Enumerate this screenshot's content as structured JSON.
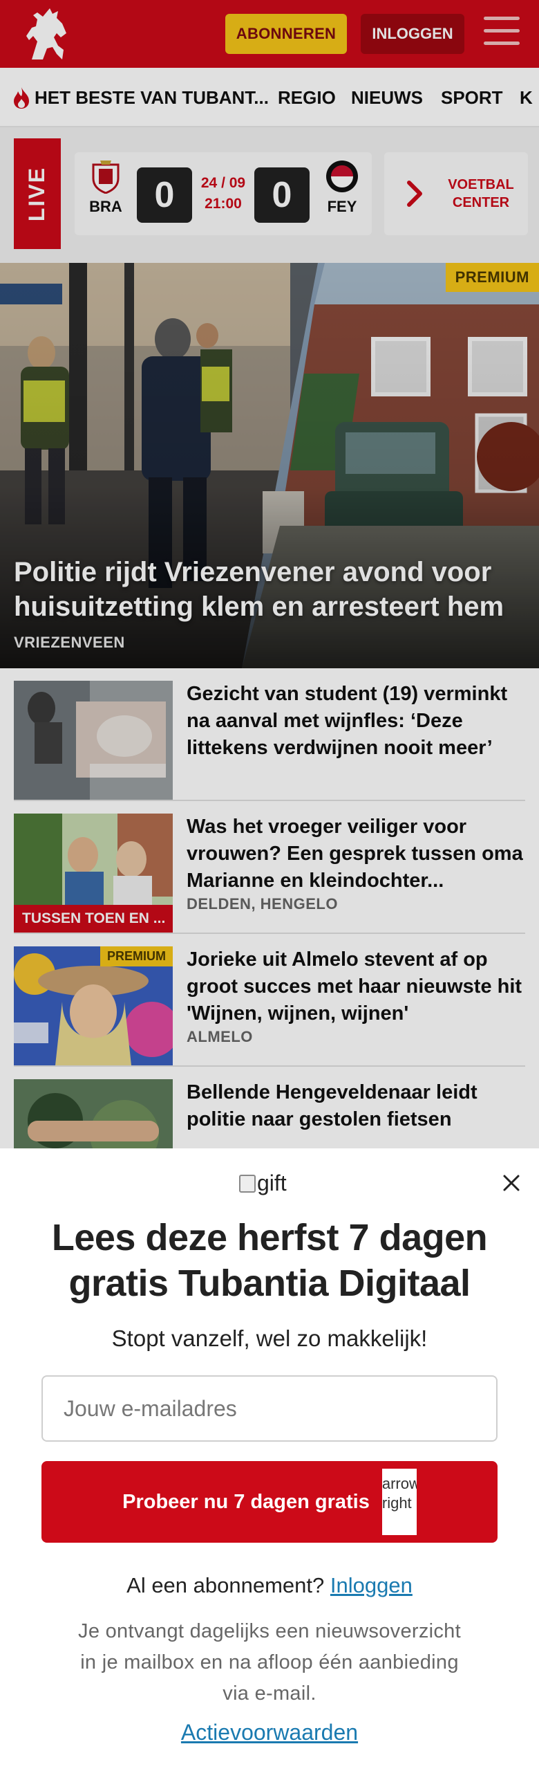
{
  "header": {
    "subscribe_label": "ABONNEREN",
    "login_label": "INLOGGEN",
    "brand_color": "#cc0a18"
  },
  "nav": {
    "items": [
      {
        "label": "HET BESTE VAN TUBANT..."
      },
      {
        "label": "REGIO"
      },
      {
        "label": "NIEUWS"
      },
      {
        "label": "SPORT"
      },
      {
        "label": "K"
      }
    ]
  },
  "live": {
    "tag": "LIVE",
    "home_team": "BRA",
    "away_team": "FEY",
    "home_score": "0",
    "away_score": "0",
    "date": "24 / 09",
    "time": "21:00",
    "voetbal_line1": "VOETBAL",
    "voetbal_line2": "CENTER"
  },
  "hero": {
    "badge": "PREMIUM",
    "title": "Politie rijdt Vriezenvener avond voor huisuitzetting klem en arresteert hem",
    "tag": "VRIEZENVEEN"
  },
  "articles": [
    {
      "title": "Gezicht van student (19) verminkt na aanval met wijnfles: ‘Deze littekens verdwijnen nooit meer’",
      "tag": "",
      "thumb_label": "",
      "premium": ""
    },
    {
      "title": "Was het vroeger veiliger voor vrouwen? Een gesprek tussen oma Marianne en kleindochter...",
      "tag": "DELDEN, HENGELO",
      "thumb_label": "TUSSEN TOEN EN ...",
      "premium": ""
    },
    {
      "title": "Jorieke uit Almelo stevent af op groot succes met haar nieuwste hit 'Wijnen, wijnen, wijnen'",
      "tag": "ALMELO",
      "thumb_label": "",
      "premium": "PREMIUM"
    },
    {
      "title": "Bellende Hengeveldenaar leidt politie naar gestolen fietsen",
      "tag": "",
      "thumb_label": "",
      "premium": ""
    }
  ],
  "modal": {
    "gift_alt": "gift",
    "title": "Lees deze herfst 7 dagen gratis Tubantia Digitaal",
    "subtitle": "Stopt vanzelf, wel zo makkelijk!",
    "email_placeholder": "Jouw e-mailadres",
    "cta_label": "Probeer nu 7 dagen gratis",
    "cta_img_alt": "arrow right",
    "login_prompt": "Al een abonnement?",
    "login_link": "Inloggen",
    "info": "Je ontvangt dagelijks een nieuwsoverzicht in je mailbox en na afloop één aanbieding via e-mail.",
    "terms": "Actievoorwaarden"
  }
}
